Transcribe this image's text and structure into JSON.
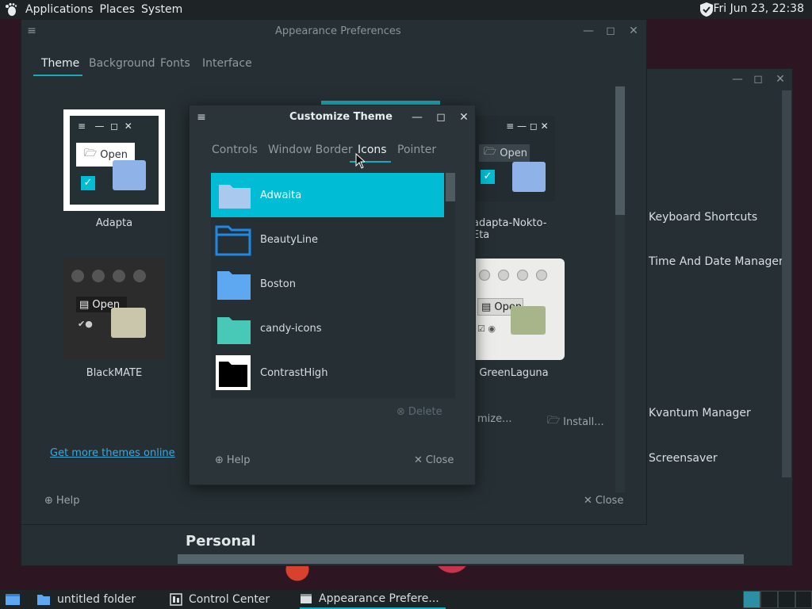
{
  "top_panel": {
    "menus": [
      "Applications",
      "Places",
      "System"
    ],
    "clock": "Fri Jun 23, 22:38"
  },
  "control_center": {
    "side_items": [
      "Keyboard Shortcuts",
      "Time And Date Manager",
      "Kvantum Manager",
      "Screensaver"
    ],
    "section_heading": "Personal"
  },
  "appearance": {
    "title": "Appearance Preferences",
    "tabs": [
      "Theme",
      "Background",
      "Fonts",
      "Interface"
    ],
    "themes": [
      "Adapta",
      "adapta-Nokto-Eta",
      "BlackMATE",
      "GreenLaguna"
    ],
    "open_label": "Open",
    "more_themes_link": "Get more themes online",
    "customize_label": "mize...",
    "install_label": "Install...",
    "help_label": "Help",
    "close_label": "Close"
  },
  "customize": {
    "title": "Customize Theme",
    "tabs": [
      "Controls",
      "Window Border",
      "Icons",
      "Pointer"
    ],
    "icons": [
      {
        "name": "Adwaita",
        "color": "#a9c9ef"
      },
      {
        "name": "BeautyLine",
        "color": "#1e88e5"
      },
      {
        "name": "Boston",
        "color": "#5ea8f2"
      },
      {
        "name": "candy-icons",
        "color": "#48c9b8"
      },
      {
        "name": "ContrastHigh",
        "color": "#000000"
      }
    ],
    "delete_label": "Delete",
    "help_label": "Help",
    "close_label": "Close"
  },
  "taskbar": {
    "tasks": [
      "untitled folder",
      "Control Center",
      "Appearance Prefere..."
    ]
  },
  "colors": {
    "accent": "#00bcd4",
    "link": "#3fa7d6"
  }
}
